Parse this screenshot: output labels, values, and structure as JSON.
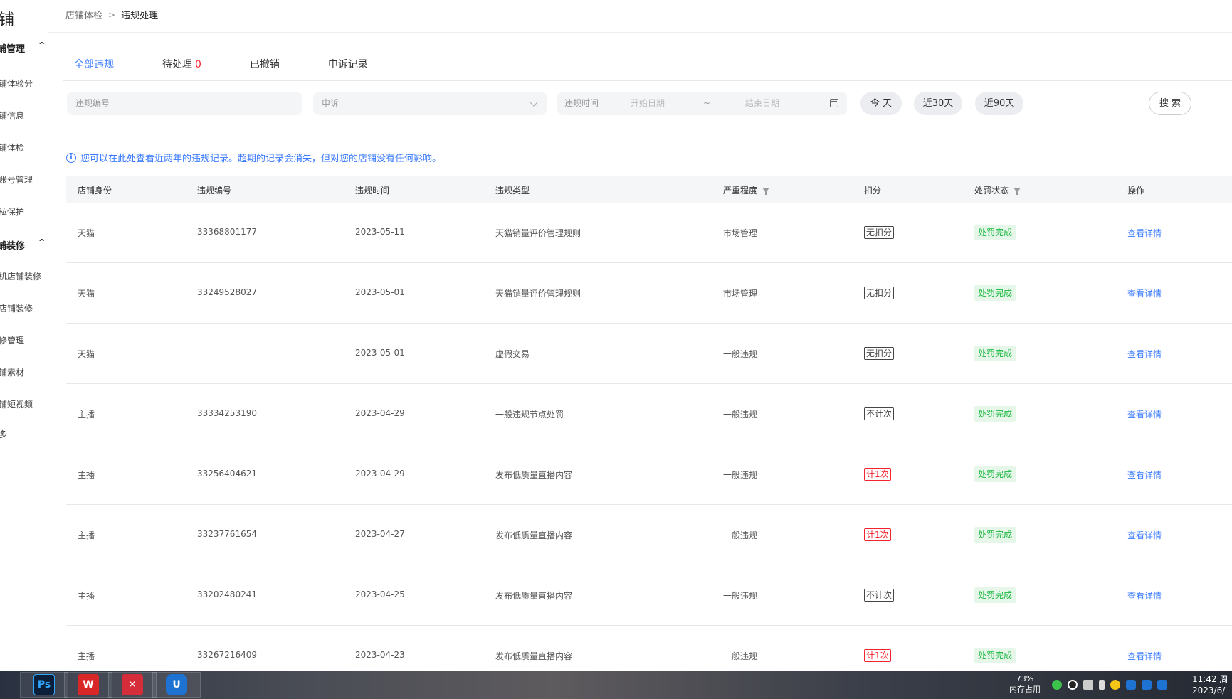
{
  "sidebar": {
    "logo": "铺",
    "groups": [
      {
        "label": "铺管理",
        "chevron": "^"
      },
      {
        "label": "铺装修",
        "chevron": "^"
      }
    ],
    "items": [
      "铺体验分",
      "铺信息",
      "铺体检",
      "账号管理",
      "私保护",
      "机店铺装修",
      "店铺装修",
      "修管理",
      "铺素材",
      "铺短视频",
      "多"
    ]
  },
  "breadcrumb": {
    "parent": "店铺体检",
    "separator": ">",
    "current": "违规处理"
  },
  "tabs": [
    {
      "label": "全部违规"
    },
    {
      "label": "待处理",
      "count": "0"
    },
    {
      "label": "已撤销"
    },
    {
      "label": "申诉记录"
    }
  ],
  "filters": {
    "id_placeholder": "违规编号",
    "appeal_placeholder": "申诉",
    "date_label": "违规时间",
    "start_placeholder": "开始日期",
    "tilde": "~",
    "end_placeholder": "结束日期",
    "today": "今 天",
    "last30": "近30天",
    "last90": "近90天",
    "search": "搜 索"
  },
  "notice": {
    "icon": "i",
    "text": "您可以在此处查看近两年的违规记录。超期的记录会消失，但对您的店铺没有任何影响。"
  },
  "table": {
    "headers": [
      "店铺身份",
      "违规编号",
      "违规时间",
      "违规类型",
      "严重程度",
      "扣分",
      "处罚状态",
      "操作"
    ],
    "rows": [
      {
        "identity": "天猫",
        "id": "33368801177",
        "date": "2023-05-11",
        "type": "天猫销量评价管理规则",
        "severity": "市场管理",
        "deduction": "无扣分",
        "tag_color": "#444444",
        "status": "处罚完成",
        "action": "查看详情"
      },
      {
        "identity": "天猫",
        "id": "33249528027",
        "date": "2023-05-01",
        "type": "天猫销量评价管理规则",
        "severity": "市场管理",
        "deduction": "无扣分",
        "tag_color": "#444444",
        "status": "处罚完成",
        "action": "查看详情"
      },
      {
        "identity": "天猫",
        "id": "--",
        "date": "2023-05-01",
        "type": "虚假交易",
        "severity": "一般违规",
        "deduction": "无扣分",
        "tag_color": "#444444",
        "status": "处罚完成",
        "action": "查看详情"
      },
      {
        "identity": "主播",
        "id": "33334253190",
        "date": "2023-04-29",
        "type": "一般违规节点处罚",
        "severity": "一般违规",
        "deduction": "不计次",
        "tag_color": "#444444",
        "status": "处罚完成",
        "action": "查看详情"
      },
      {
        "identity": "主播",
        "id": "33256404621",
        "date": "2023-04-29",
        "type": "发布低质量直播内容",
        "severity": "一般违规",
        "deduction": "计1次",
        "tag_color": "#f5222d",
        "status": "处罚完成",
        "action": "查看详情"
      },
      {
        "identity": "主播",
        "id": "33237761654",
        "date": "2023-04-27",
        "type": "发布低质量直播内容",
        "severity": "一般违规",
        "deduction": "计1次",
        "tag_color": "#f5222d",
        "status": "处罚完成",
        "action": "查看详情"
      },
      {
        "identity": "主播",
        "id": "33202480241",
        "date": "2023-04-25",
        "type": "发布低质量直播内容",
        "severity": "一般违规",
        "deduction": "不计次",
        "tag_color": "#444444",
        "status": "处罚完成",
        "action": "查看详情"
      },
      {
        "identity": "主播",
        "id": "33267216409",
        "date": "2023-04-23",
        "type": "发布低质量直播内容",
        "severity": "一般违规",
        "deduction": "计1次",
        "tag_color": "#f5222d",
        "status": "处罚完成",
        "action": "查看详情"
      }
    ]
  },
  "taskbar": {
    "apps": [
      {
        "name": "photoshop-icon",
        "label": "Ps"
      },
      {
        "name": "wps-icon",
        "label": "W"
      },
      {
        "name": "xmind-icon",
        "label": "✕"
      },
      {
        "name": "uu-icon",
        "label": "U"
      }
    ],
    "memory_percent": "73%",
    "memory_label": "内存占用",
    "time": "11:42 周",
    "date": "2023/6/"
  },
  "colors": {
    "accent": "#3a7bff",
    "danger": "#f5222d",
    "success": "#19b83f"
  }
}
